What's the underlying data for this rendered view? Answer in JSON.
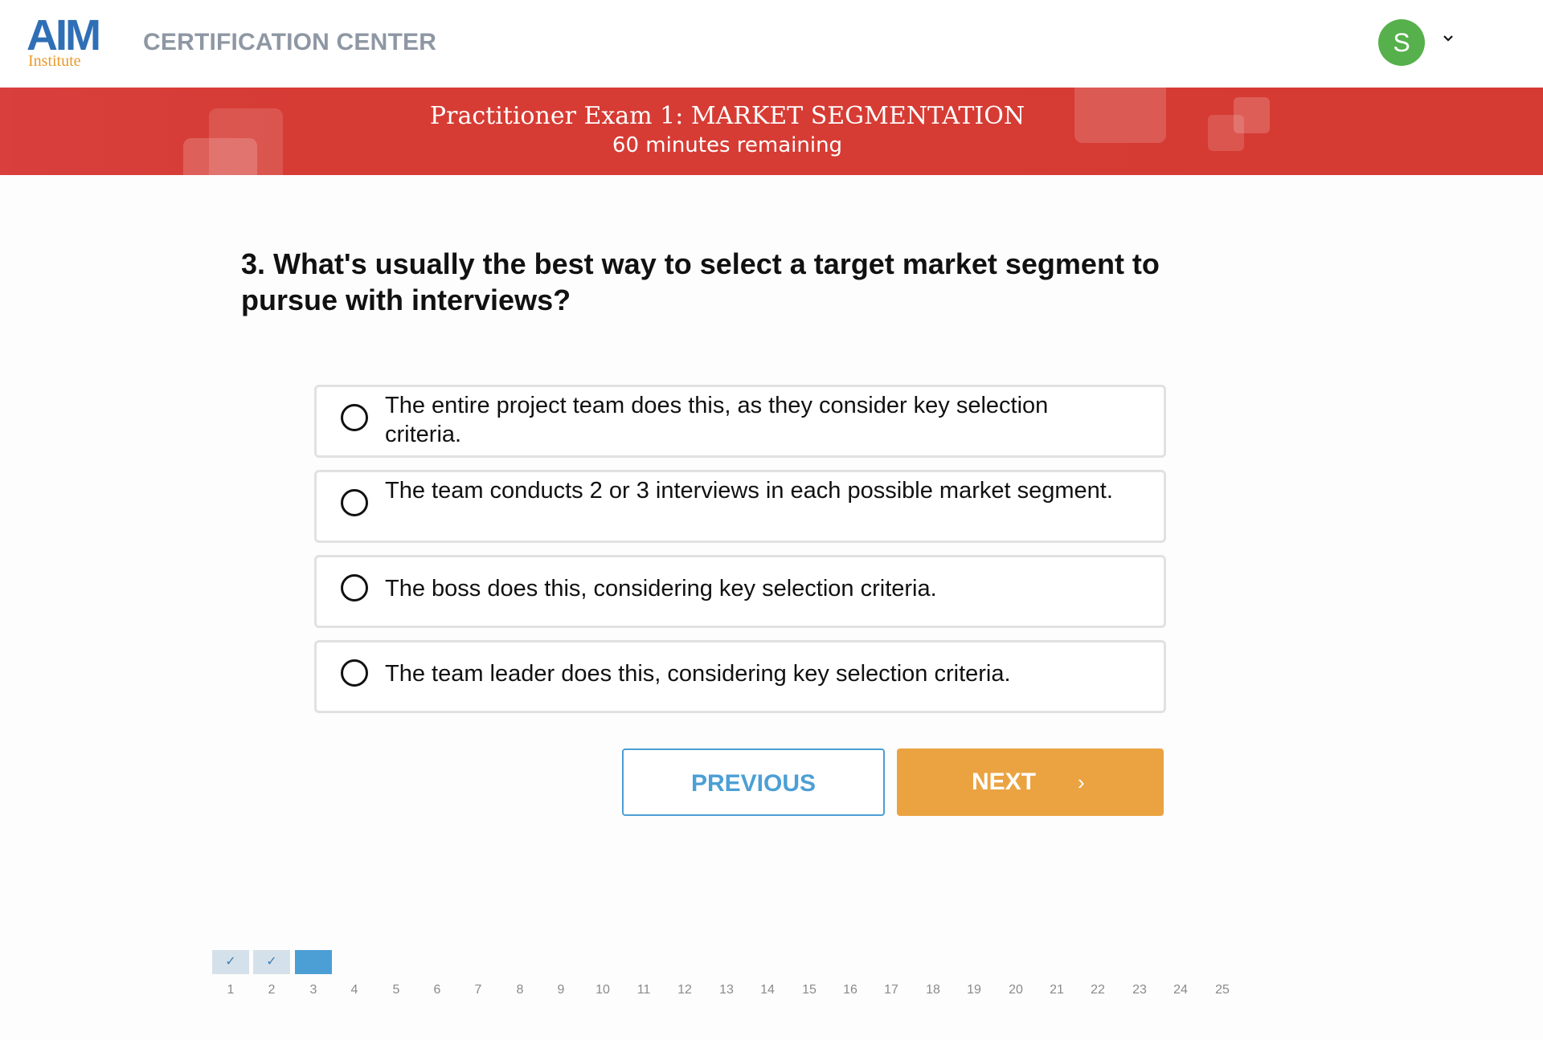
{
  "header": {
    "logo_main": "AIM",
    "logo_sub": "Institute",
    "app_title": "CERTIFICATION CENTER",
    "avatar_initial": "S",
    "avatar_color": "#56b04b"
  },
  "banner": {
    "title": "Practitioner Exam 1: MARKET SEGMENTATION",
    "time_remaining": "60 minutes remaining",
    "color": "#d53b33"
  },
  "question": {
    "text": "3. What's usually the best way to select a target market segment to pursue with interviews?",
    "options": [
      {
        "text": "The entire project team does this, as they consider key selection criteria.",
        "selected": false
      },
      {
        "text": "The team conducts 2 or 3 interviews in each possible market segment.",
        "selected": false
      },
      {
        "text": "The boss does this, considering key selection criteria.",
        "selected": false
      },
      {
        "text": "The team leader does this, considering key selection criteria.",
        "selected": false
      }
    ]
  },
  "nav": {
    "previous_label": "PREVIOUS",
    "next_label": "NEXT",
    "next_arrow": "›",
    "accent_blue": "#4c9fd5",
    "accent_orange": "#eba342"
  },
  "progress": {
    "total": 25,
    "current": 3,
    "answered": [
      1,
      2
    ],
    "check_glyph": "✓",
    "numbers": [
      "1",
      "2",
      "3",
      "4",
      "5",
      "6",
      "7",
      "8",
      "9",
      "10",
      "11",
      "12",
      "13",
      "14",
      "15",
      "16",
      "17",
      "18",
      "19",
      "20",
      "21",
      "22",
      "23",
      "24",
      "25"
    ]
  }
}
